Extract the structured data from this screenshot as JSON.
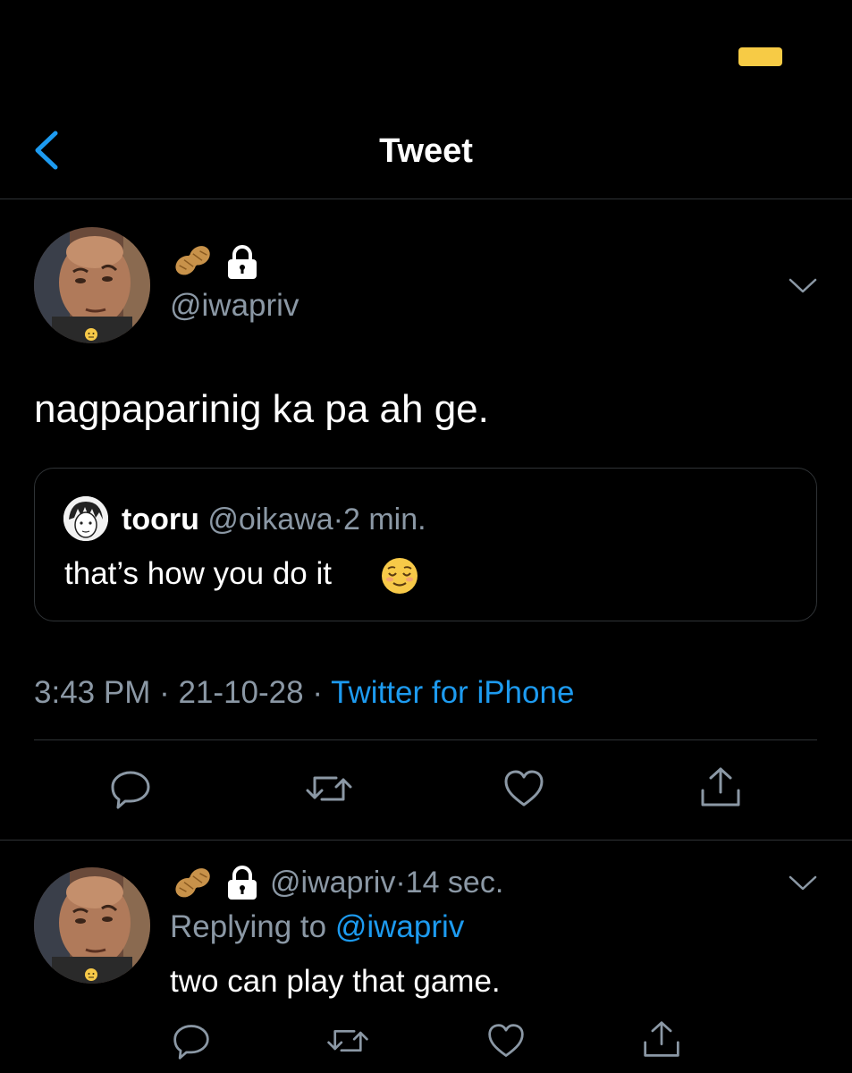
{
  "status_bar": {
    "battery_color": "#f7cb45"
  },
  "header": {
    "title": "Tweet",
    "back_icon": "chevron-left-icon"
  },
  "tweet": {
    "handle": "@iwapriv",
    "name_icons": [
      "peanut-emoji",
      "lock-icon"
    ],
    "text": "nagpaparinig ka pa ah ge.",
    "quoted": {
      "name": "tooru",
      "handle": "@oikawa",
      "separator": "·",
      "time": "2 min.",
      "text": "that’s how you do it",
      "emoji": "relieved-face-emoji"
    },
    "meta": {
      "time": "3:43 PM",
      "separator": "·",
      "date": "21-10-28",
      "source": "Twitter for iPhone"
    },
    "actions": [
      "reply-icon",
      "retweet-icon",
      "like-icon",
      "share-icon"
    ]
  },
  "reply": {
    "handle": "@iwapriv",
    "separator": "·",
    "time": "14 sec.",
    "replying_label": "Replying to",
    "replying_to": "@iwapriv",
    "text": "two can play that game.",
    "actions": [
      "reply-icon",
      "retweet-icon",
      "like-icon",
      "share-icon"
    ]
  },
  "colors": {
    "background": "#000000",
    "accent": "#1d9bf0",
    "secondary_text": "#8b98a5",
    "border": "#2f3336"
  }
}
